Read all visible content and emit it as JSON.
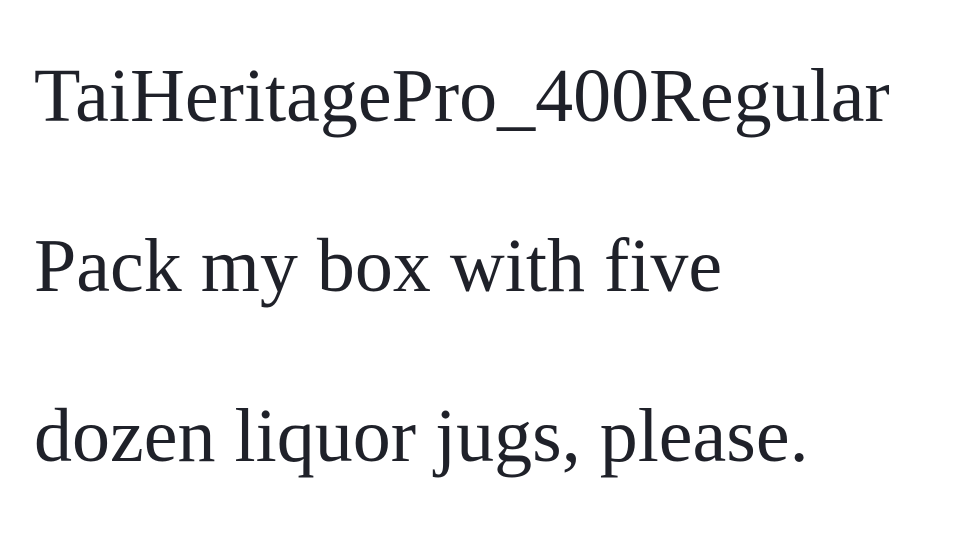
{
  "font_name": "TaiHeritagePro_400Regular",
  "sample_lines": [
    "Pack my box with five",
    "dozen liquor jugs, please."
  ],
  "colors": {
    "background": "#ffffff",
    "text": "#1f2129"
  }
}
